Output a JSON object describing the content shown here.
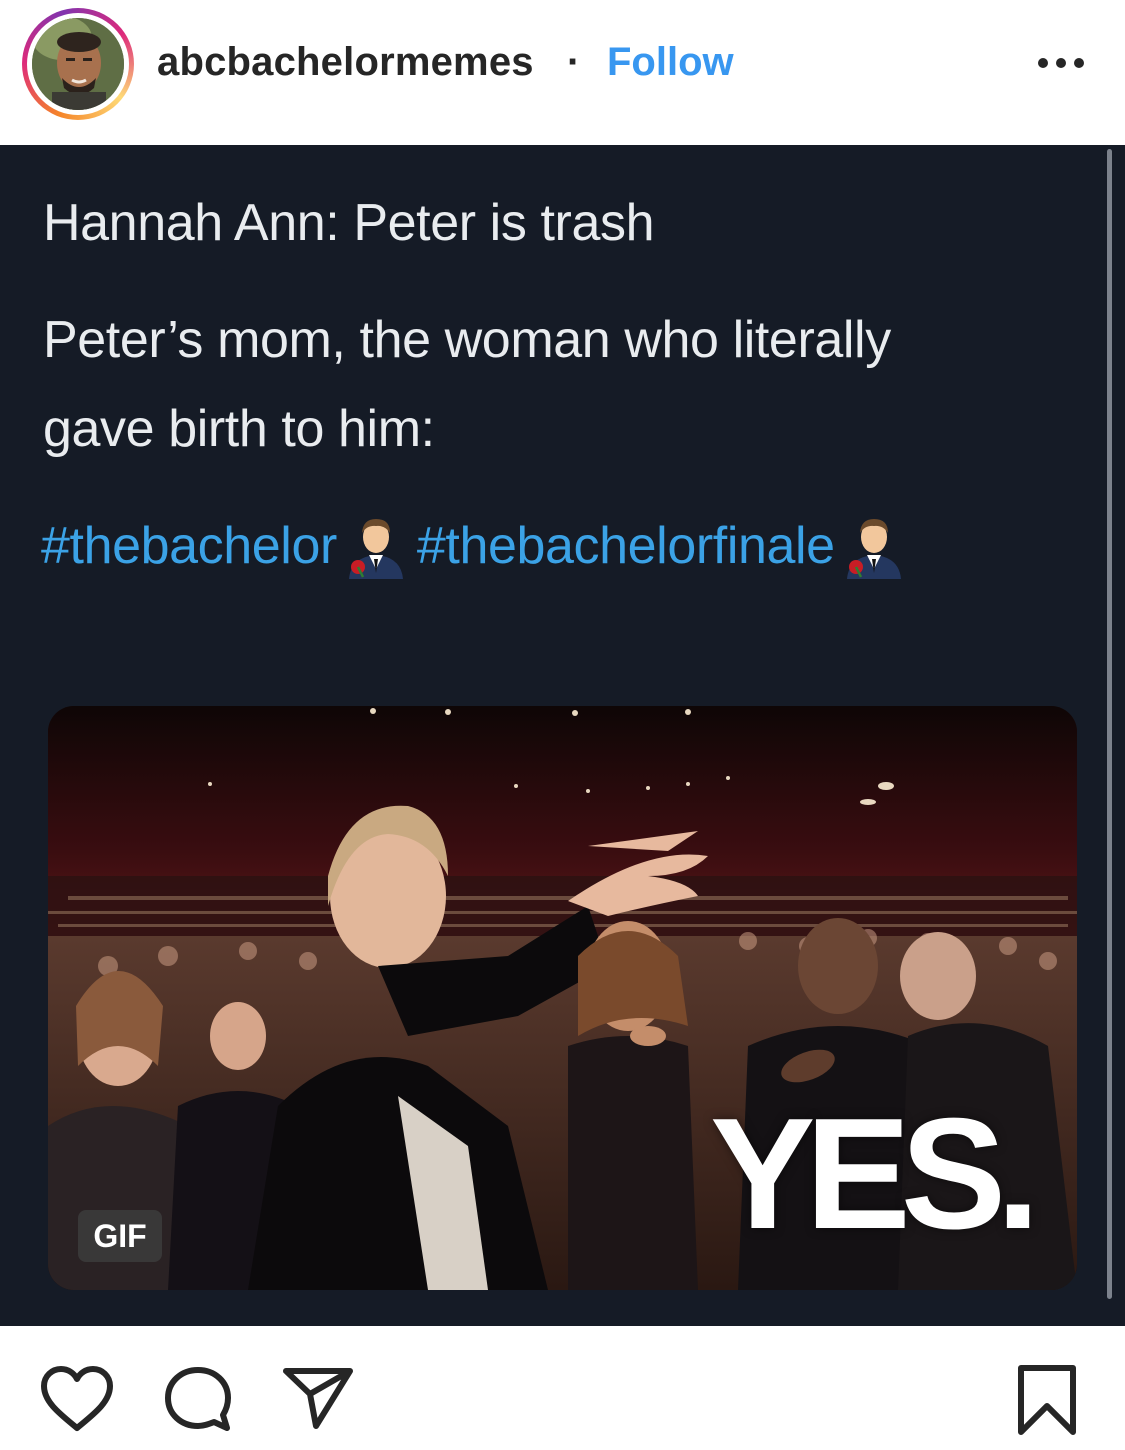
{
  "header": {
    "username": "abcbachelormemes",
    "separator": "·",
    "follow_label": "Follow"
  },
  "post": {
    "line1": "Hannah Ann: Peter is trash",
    "line2": "Peter’s mom, the woman who literally",
    "line3": "gave birth to him:",
    "hashtags": [
      "#thebachelor",
      "#thebachelorfinale"
    ],
    "gif_badge": "GIF",
    "gif_caption": "YES."
  },
  "colors": {
    "follow": "#3897f0",
    "tweet_bg": "#151b26",
    "hashtag": "#3ba2e6",
    "text": "#262626"
  },
  "icons": [
    "avatar",
    "more-options-icon",
    "bachelor-rose-emoji",
    "heart-icon",
    "comment-icon",
    "share-icon",
    "bookmark-icon"
  ]
}
